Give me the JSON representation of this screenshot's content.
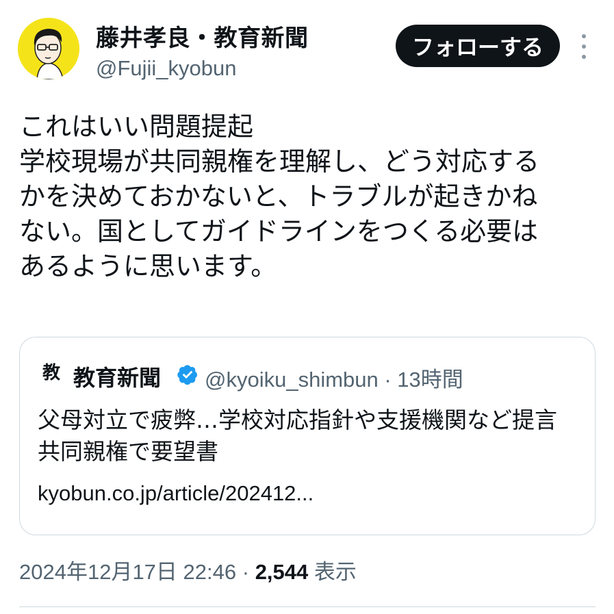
{
  "author": {
    "display_name": "藤井孝良・教育新聞",
    "handle": "@Fujii_kyobun"
  },
  "follow_label": "フォローする",
  "tweet_text": "これはいい問題提起\n学校現場が共同親権を理解し、どう対応する\nかを決めておかないと、トラブルが起きかね\nない。国としてガイドラインをつくる必要は\nあるように思います。",
  "quote": {
    "logo_text": "教",
    "display_name": "教育新聞",
    "handle_time": "@kyoiku_shimbun · 13時間",
    "text": "父母対立で疲弊…学校対応指針や支援機関など提言 共同親権で要望書",
    "link": "kyobun.co.jp/article/202412..."
  },
  "meta": {
    "timestamp": "2024年12月17日 22:46 ·",
    "views": "2,544",
    "views_label": "表示"
  },
  "colors": {
    "button_bg": "#0f1419",
    "secondary_text": "#536471",
    "verified": "#1d9bf0",
    "avatar_bg": "#f5e31a"
  }
}
